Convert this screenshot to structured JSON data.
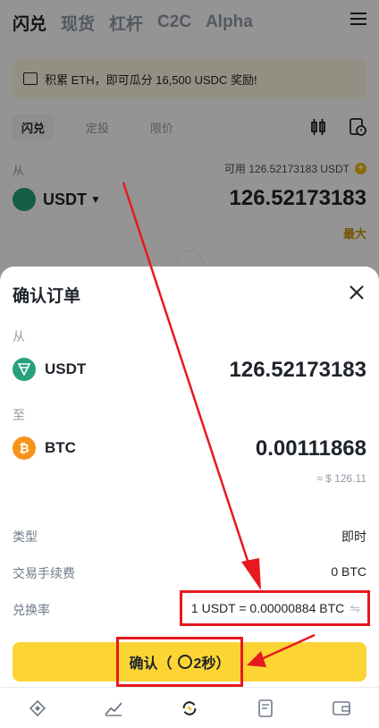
{
  "nav": {
    "tabs": [
      "闪兑",
      "现货",
      "杠杆",
      "C2C",
      "Alpha"
    ]
  },
  "banner": {
    "text": "积累 ETH，即可瓜分 16,500 USDC 奖励!"
  },
  "subtabs": [
    "闪兑",
    "定投",
    "限价"
  ],
  "from_section": {
    "label": "从",
    "available": "可用 126.52173183 USDT",
    "coin": "USDT",
    "amount": "126.52173183",
    "max": "最大"
  },
  "modal": {
    "title": "确认订单",
    "from_label": "从",
    "from_coin": "USDT",
    "from_amount": "126.52173183",
    "to_label": "至",
    "to_coin": "BTC",
    "to_amount": "0.00111868",
    "approx": "≈ $ 126.11",
    "rows": [
      {
        "label": "类型",
        "value": "即时"
      },
      {
        "label": "交易手续费",
        "value": "0 BTC"
      },
      {
        "label": "兑换率",
        "value": "1 USDT = 0.00000884 BTC"
      }
    ],
    "confirm": {
      "label": "确认（",
      "countdown": "2秒）"
    }
  },
  "colors": {
    "accent": "#fcd535",
    "annotation": "#e6191e"
  }
}
